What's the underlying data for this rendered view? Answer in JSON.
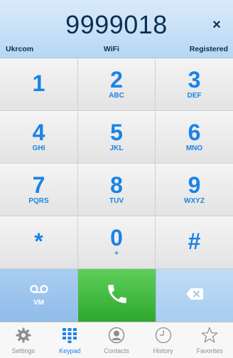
{
  "header": {
    "number": "9999018",
    "close_label": "×",
    "carrier": "Ukrcom",
    "network": "WiFi",
    "status": "Registered"
  },
  "keypad": {
    "keys": [
      {
        "digit": "1",
        "letters": ""
      },
      {
        "digit": "2",
        "letters": "ABC"
      },
      {
        "digit": "3",
        "letters": "DEF"
      },
      {
        "digit": "4",
        "letters": "GHI"
      },
      {
        "digit": "5",
        "letters": "JKL"
      },
      {
        "digit": "6",
        "letters": "MNO"
      },
      {
        "digit": "7",
        "letters": "PQRS"
      },
      {
        "digit": "8",
        "letters": "TUV"
      },
      {
        "digit": "9",
        "letters": "WXYZ"
      },
      {
        "digit": "*",
        "letters": ""
      },
      {
        "digit": "0",
        "letters": "+"
      },
      {
        "digit": "#",
        "letters": ""
      }
    ]
  },
  "actions": {
    "voicemail_label": "VM",
    "voicemail_icon": "voicemail-icon",
    "call_icon": "phone-icon",
    "delete_icon": "backspace-icon"
  },
  "tabbar": {
    "tabs": [
      {
        "label": "Settings",
        "icon": "gear-icon",
        "active": false
      },
      {
        "label": "Keypad",
        "icon": "keypad-icon",
        "active": true
      },
      {
        "label": "Contacts",
        "icon": "contacts-icon",
        "active": false
      },
      {
        "label": "History",
        "icon": "clock-icon",
        "active": false
      },
      {
        "label": "Favorites",
        "icon": "star-icon",
        "active": false
      }
    ]
  },
  "colors": {
    "accent": "#1a83e6",
    "header_bg": "#c8e1f7",
    "call_green": "#3cb83a"
  }
}
